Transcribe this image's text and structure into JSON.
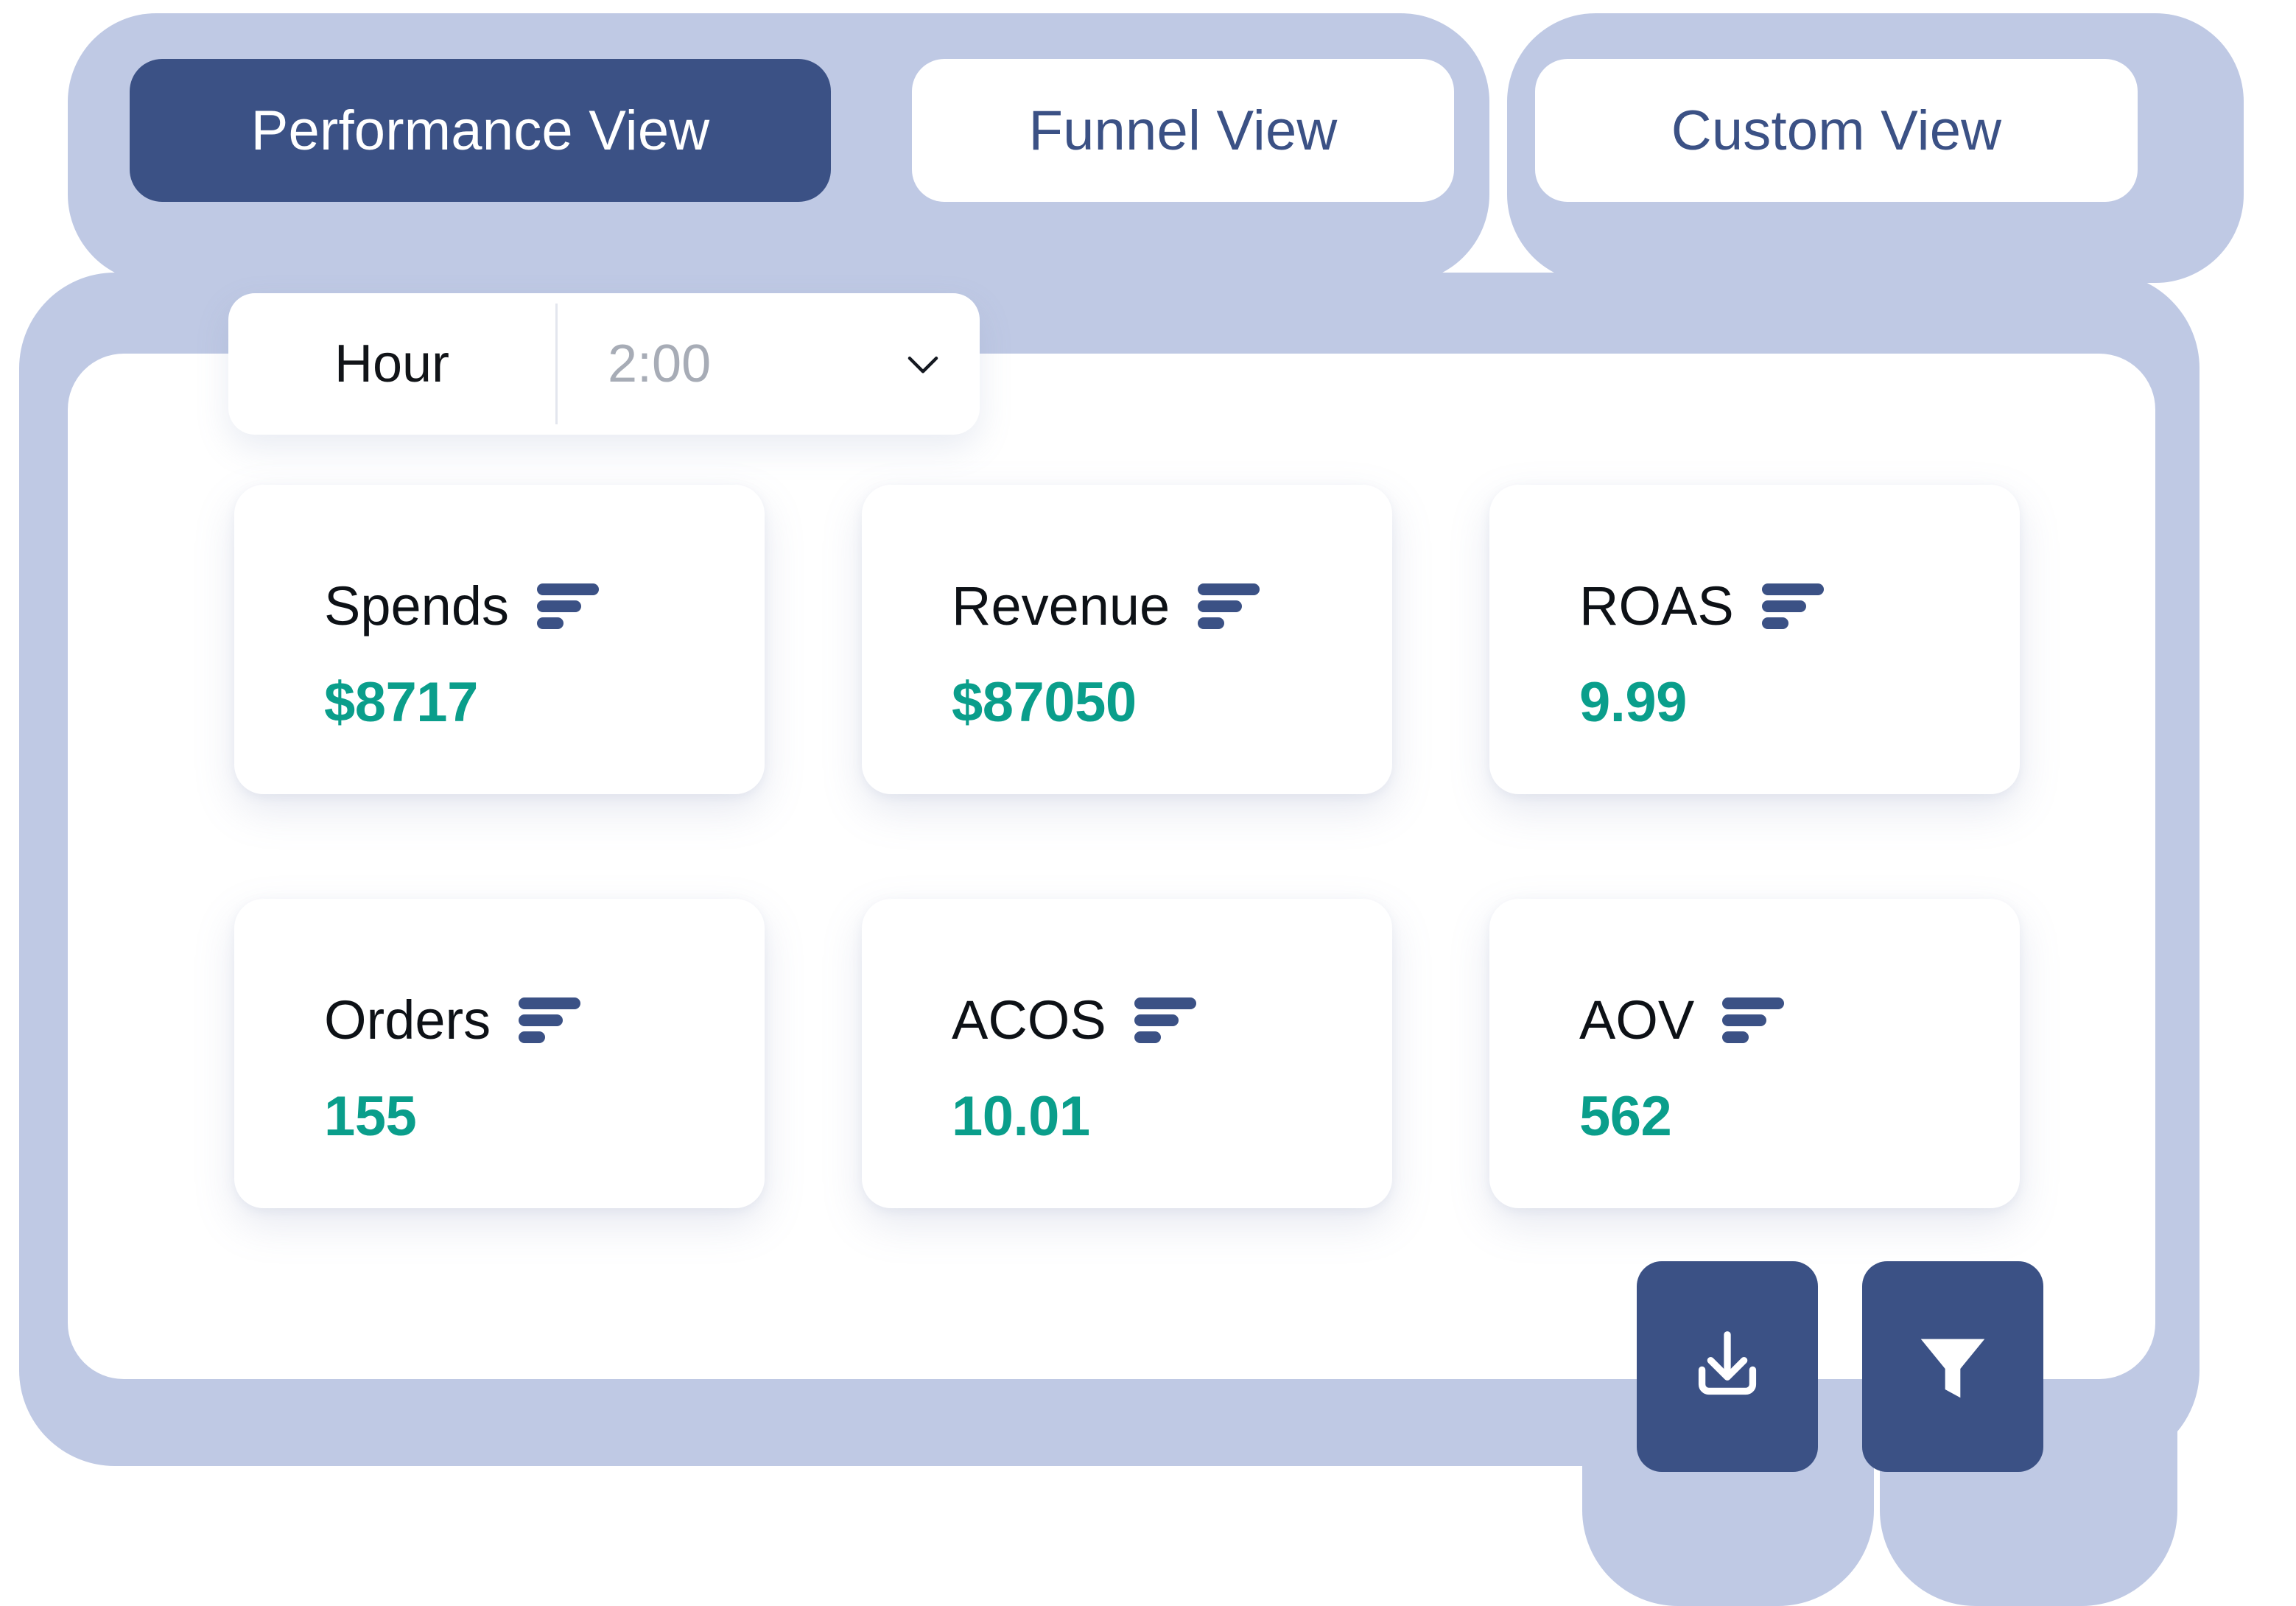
{
  "theme": {
    "periwinkle": "#bfc9e4",
    "navy": "#3b5185",
    "teal": "#0a9e8b",
    "panel_white": "#ffffff",
    "muted_text": "#a7acb6"
  },
  "tabs": [
    {
      "label": "Performance View",
      "active": true
    },
    {
      "label": "Funnel View",
      "active": false
    },
    {
      "label": "Custom View",
      "active": false
    }
  ],
  "hour_selector": {
    "label": "Hour",
    "value": "2:00",
    "placeholder": "2:00",
    "chevron_icon": "chevron-down-icon"
  },
  "metrics": [
    {
      "title": "Spends",
      "value": "$8717",
      "icon": "bar-chart-icon"
    },
    {
      "title": "Revenue",
      "value": "$87050",
      "icon": "bar-chart-icon"
    },
    {
      "title": "ROAS",
      "value": "9.99",
      "icon": "bar-chart-icon"
    },
    {
      "title": "Orders",
      "value": "155",
      "icon": "bar-chart-icon"
    },
    {
      "title": "ACOS",
      "value": "10.01",
      "icon": "bar-chart-icon"
    },
    {
      "title": "AOV",
      "value": "562",
      "icon": "bar-chart-icon"
    }
  ],
  "actions": [
    {
      "name": "download-button",
      "icon": "download-icon"
    },
    {
      "name": "filter-button",
      "icon": "filter-funnel-icon"
    }
  ]
}
